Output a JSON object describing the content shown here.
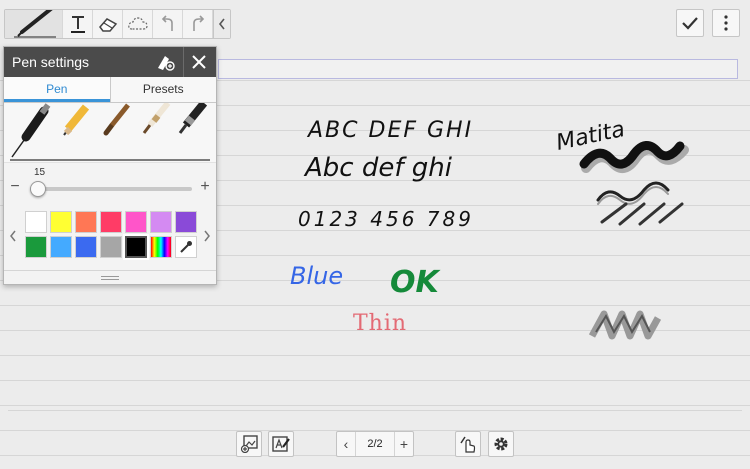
{
  "toolbar": {
    "tools": [
      "pen-icon",
      "text-icon",
      "eraser-icon",
      "lasso-icon",
      "undo-icon",
      "redo-icon",
      "collapse-toolbar-icon"
    ]
  },
  "top_right": {
    "icons": [
      "checkmark-icon",
      "more-menu-icon"
    ]
  },
  "pen_settings": {
    "title": "Pen settings",
    "tabs": [
      "Pen",
      "Presets"
    ],
    "active_tab": "Pen",
    "size": {
      "value": "15",
      "minus": "−",
      "plus": "+",
      "level_fraction": 0.05
    },
    "palette": {
      "colors": [
        "#ffffff",
        "#ffff33",
        "#ff7755",
        "#ff3c66",
        "#ff55c9",
        "#d48af2",
        "#8a4ad8",
        "#1a9a3c",
        "#44aaff",
        "#3b6af0",
        "#a6a6a6",
        "#000000"
      ],
      "selected": "#000000"
    }
  },
  "pager": {
    "label": "2/2",
    "prev": "‹",
    "next": "+"
  },
  "ink": {
    "letters_caps": "ABC DEF GHI",
    "letters_lower": "Abc def ghi",
    "digits": "0123 456 789",
    "blue_word": "Blue",
    "ok_word": "OK",
    "thin_word": "Thin",
    "matita_word": "Matita",
    "blue_color": "#3566e6",
    "green_color": "#158a3a",
    "thin_color": "#e36a74"
  }
}
